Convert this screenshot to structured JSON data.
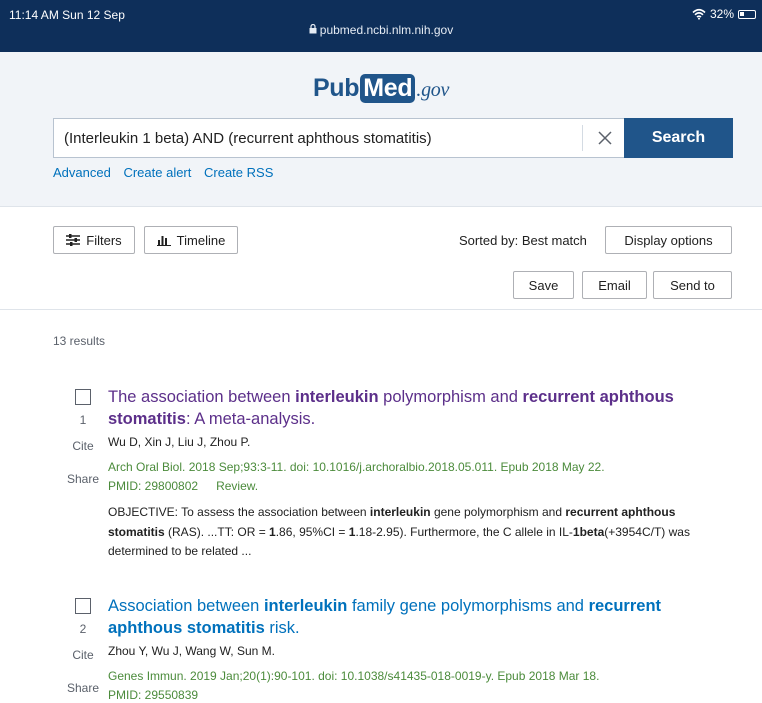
{
  "statusbar": {
    "time": "11:14 AM  Sun 12 Sep",
    "url": "pubmed.ncbi.nlm.nih.gov",
    "battery": "32%"
  },
  "header": {
    "logo_pub": "Pub",
    "logo_med": "Med",
    "logo_gov": ".gov",
    "search_value": "(Interleukin 1 beta) AND (recurrent aphthous stomatitis)",
    "search_button": "Search",
    "links": [
      "Advanced",
      "Create alert",
      "Create RSS"
    ]
  },
  "toolbar": {
    "filters": "Filters",
    "timeline": "Timeline",
    "sorted": "Sorted by: Best match",
    "display_options": "Display options",
    "save": "Save",
    "email": "Email",
    "send_to": "Send to"
  },
  "results_count": "13 results",
  "labels": {
    "cite": "Cite",
    "share": "Share"
  },
  "results": [
    {
      "rank": "1",
      "title_parts": [
        {
          "text": "The association between ",
          "bold": false
        },
        {
          "text": "interleukin",
          "bold": true
        },
        {
          "text": " polymorphism and ",
          "bold": false
        },
        {
          "text": "recurrent aphthous stomatitis",
          "bold": true
        },
        {
          "text": ": A meta-analysis.",
          "bold": false
        }
      ],
      "authors": "Wu D, Xin J, Liu J, Zhou P.",
      "citation": "Arch Oral Biol. 2018 Sep;93:3-11. doi: 10.1016/j.archoralbio.2018.05.011. Epub 2018 May 22.",
      "pmid": "PMID: 29800802",
      "type": "Review.",
      "snippet_parts": [
        {
          "text": "OBJECTIVE: To assess the association between ",
          "bold": false
        },
        {
          "text": "interleukin",
          "bold": true
        },
        {
          "text": " gene polymorphism and ",
          "bold": false
        },
        {
          "text": "recurrent aphthous stomatitis",
          "bold": true
        },
        {
          "text": " (RAS). ...TT: OR = ",
          "bold": false
        },
        {
          "text": "1",
          "bold": true
        },
        {
          "text": ".86, 95%CI = ",
          "bold": false
        },
        {
          "text": "1",
          "bold": true
        },
        {
          "text": ".18-2.95). Furthermore, the C allele in IL-",
          "bold": false
        },
        {
          "text": "1beta",
          "bold": true
        },
        {
          "text": "(+3954C/T) was determined to be related ...",
          "bold": false
        }
      ]
    },
    {
      "rank": "2",
      "title_parts": [
        {
          "text": "Association between ",
          "bold": false
        },
        {
          "text": "interleukin",
          "bold": true
        },
        {
          "text": " family gene polymorphisms and ",
          "bold": false
        },
        {
          "text": "recurrent aphthous stomatitis",
          "bold": true
        },
        {
          "text": " risk.",
          "bold": false
        }
      ],
      "authors": "Zhou Y, Wu J, Wang W, Sun M.",
      "citation": "Genes Immun. 2019 Jan;20(1):90-101. doi: 10.1038/s41435-018-0019-y. Epub 2018 Mar 18.",
      "pmid": "PMID: 29550839"
    }
  ],
  "icons": {
    "lock": "lock-icon",
    "wifi": "wifi-icon",
    "battery": "battery-icon",
    "clear": "close-icon",
    "filters": "sliders-icon",
    "timeline": "bar-chart-icon"
  },
  "colors": {
    "statusbar": "#0e2f5a",
    "brand": "#20558a",
    "link": "#0071bc",
    "visited_title": "#5c2f8a",
    "citation": "#4b8b3b"
  }
}
